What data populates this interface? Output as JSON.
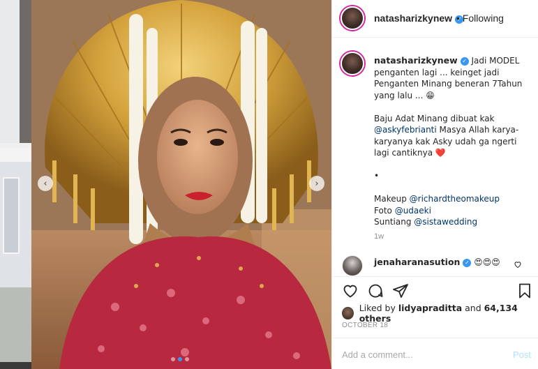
{
  "post": {
    "username": "natasharizkynew",
    "following_label": "Following",
    "bullet": "•",
    "more_glyph": "···",
    "caption": {
      "username": "natasharizkynew",
      "line1": "Jadi MODEL",
      "line2": "penganten lagi ... keinget jadi",
      "line3": "Penganten Minang beneran 7Tahun",
      "line4": "yang lalu ... ",
      "emoji1": "😁",
      "line5": "Baju Adat Minang dibuat kak",
      "mention1": "@askyfebrianti",
      "line6_rest": " Masya Allah karya-",
      "line7": "karyanya kak Asky udah ga ngerti",
      "line8": "lagi cantiknya ",
      "emoji2": "❤️",
      "dot_line": "•",
      "makeup_label": "Makeup ",
      "makeup_mention": "@richardtheomakeup",
      "foto_label": "Foto ",
      "foto_mention": "@udaeki",
      "suntiang_label": "Suntiang ",
      "suntiang_mention": "@sistawedding",
      "time": "1w"
    },
    "comment": {
      "username": "jenaharanasution",
      "text": "😍😍😍"
    },
    "likes": {
      "prefix": "Liked by ",
      "user": "lidyapraditta",
      "middle": " and ",
      "count": "64,134 others"
    },
    "date": "OCTOBER 18",
    "add_comment_placeholder": "Add a comment...",
    "post_label": "Post",
    "nav_prev": "‹",
    "nav_next": "›",
    "verified_glyph": "✓"
  },
  "colors": {
    "accent": "#3897f0",
    "mention": "#003569",
    "muted": "#8e8e8e",
    "post_disabled": "#b2dffc"
  },
  "icons": [
    "heart-icon",
    "comment-icon",
    "share-icon",
    "bookmark-icon",
    "verified-icon",
    "chevron-left-icon",
    "chevron-right-icon"
  ]
}
